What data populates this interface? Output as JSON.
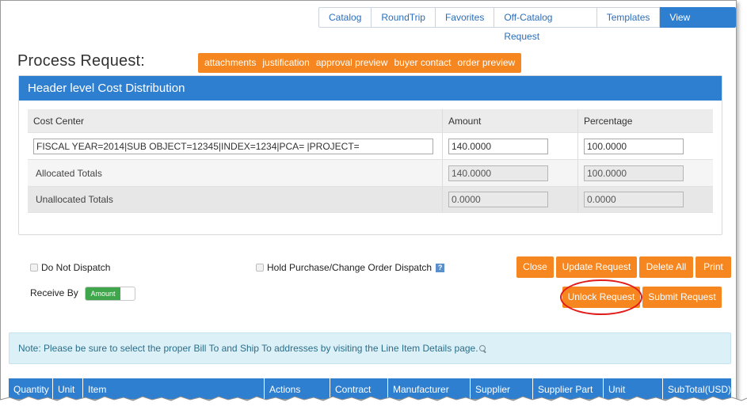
{
  "nav_tabs": [
    "Catalog",
    "RoundTrip",
    "Favorites",
    "Off-Catalog Request",
    "Templates",
    "View Request"
  ],
  "page_title": "Process Request:",
  "quick_links": [
    "attachments",
    "justification",
    "approval preview",
    "buyer contact",
    "order preview"
  ],
  "cost_distribution": {
    "header": "Header level Cost Distribution",
    "columns": [
      "Cost Center",
      "Amount",
      "Percentage"
    ],
    "cost_center_value": "FISCAL YEAR=2014|SUB OBJECT=12345|INDEX=1234|PCA= |PROJECT=",
    "amount_value": "140.0000",
    "percentage_value": "100.0000",
    "allocated_label": "Allocated Totals",
    "allocated_amount": "140.0000",
    "allocated_percentage": "100.0000",
    "unallocated_label": "Unallocated Totals",
    "unallocated_amount": "0.0000",
    "unallocated_percentage": "0.0000"
  },
  "options": {
    "do_not_dispatch": "Do Not Dispatch",
    "hold_dispatch": "Hold Purchase/Change Order Dispatch",
    "help_glyph": "?",
    "receive_by_label": "Receive By",
    "receive_by_value": "Amount"
  },
  "actions": {
    "close": "Close",
    "update_request": "Update Request",
    "delete_all": "Delete All",
    "print": "Print",
    "unlock_request": "Unlock Request",
    "submit_request": "Submit Request"
  },
  "note": "Note: Please be sure to select the proper Bill To and Ship To addresses by visiting the Line Item Details page.",
  "line_items_columns": [
    "Quantity",
    "Unit",
    "Item",
    "Actions",
    "Contract",
    "Manufacturer",
    "Supplier",
    "Supplier Part",
    "Unit",
    "SubTotal(USD)"
  ],
  "colors": {
    "accent_blue": "#2f7fd0",
    "accent_orange": "#f6861f",
    "annotation_red": "#e01b1b",
    "toggle_green": "#3fa64b"
  }
}
